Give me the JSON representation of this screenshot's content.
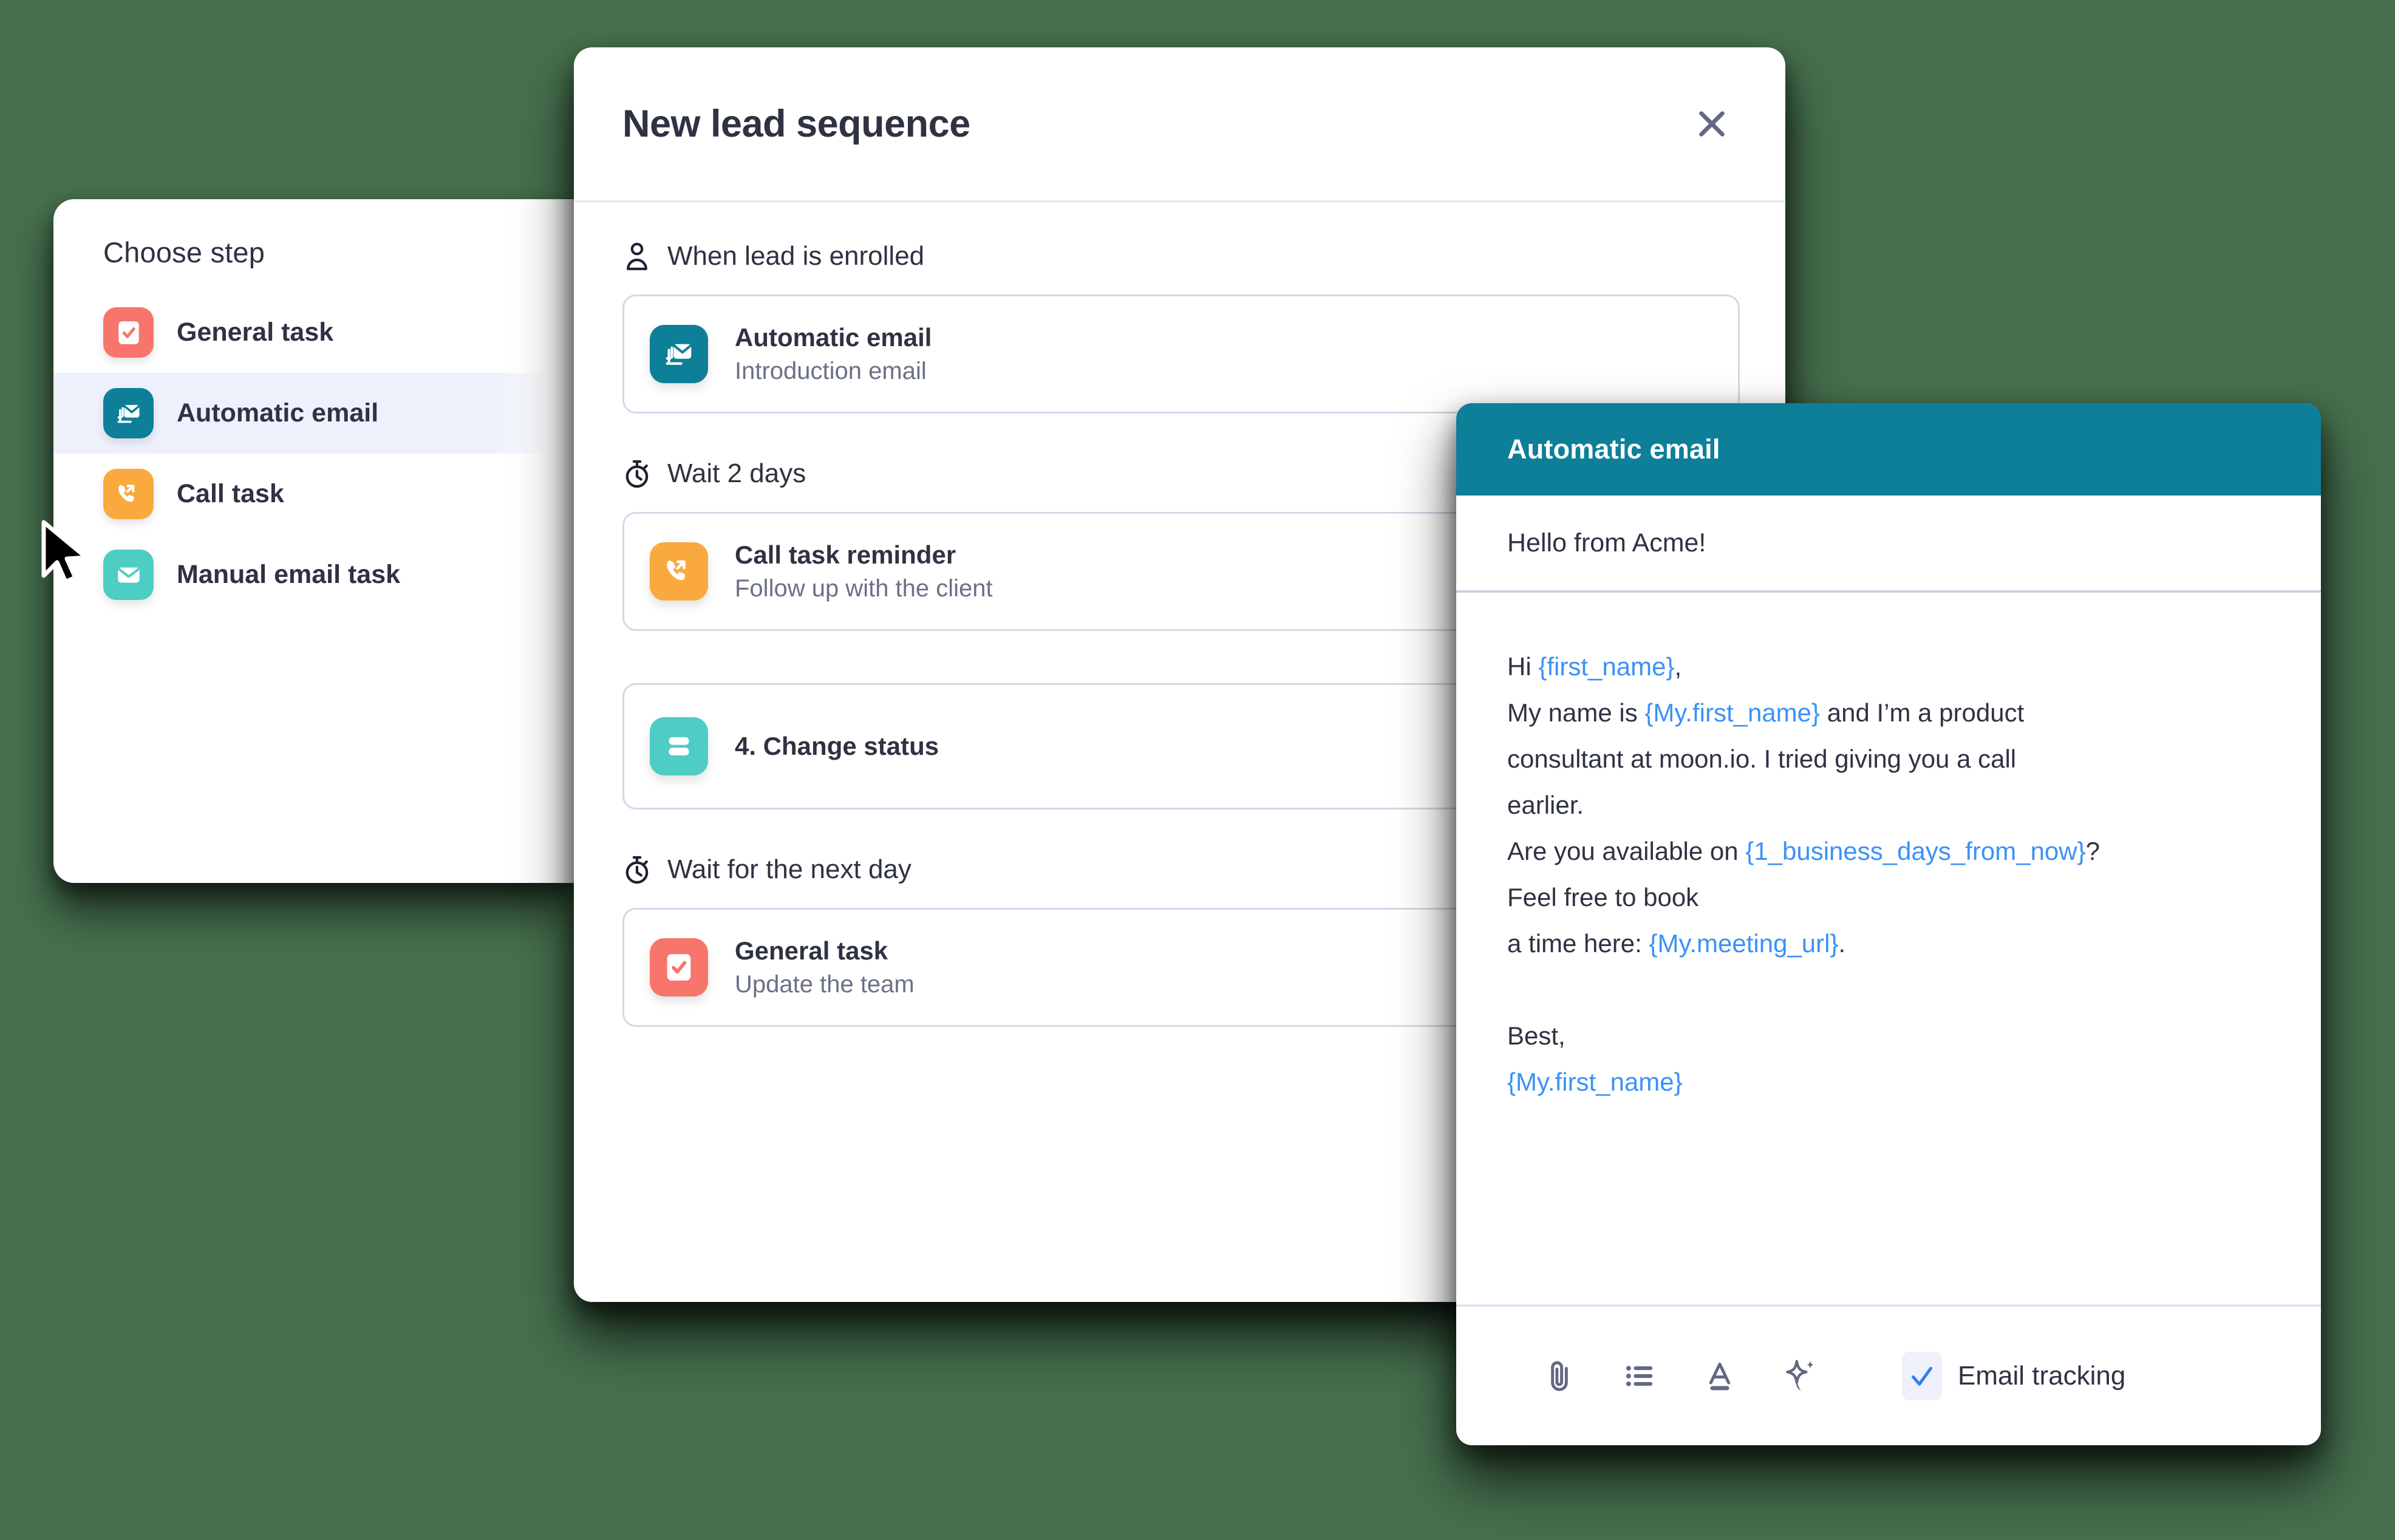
{
  "choose_step": {
    "title": "Choose step",
    "items": [
      {
        "label": "General task",
        "icon": "checkbox-task-icon",
        "color": "#f8756b",
        "selected": false
      },
      {
        "label": "Automatic email",
        "icon": "stacked-email-icon",
        "color": "#0d7f99",
        "selected": true
      },
      {
        "label": "Call task",
        "icon": "outgoing-call-icon",
        "color": "#f9a93e",
        "selected": false
      },
      {
        "label": "Manual email task",
        "icon": "envelope-icon",
        "color": "#4ecdc4",
        "selected": false
      }
    ]
  },
  "sequence_modal": {
    "title": "New lead sequence",
    "close_label": "Close",
    "sections": [
      {
        "heading": "When lead is enrolled",
        "heading_icon": "person-icon",
        "card": {
          "icon": "stacked-email-icon",
          "color": "#0d7f99",
          "title": "Automatic email",
          "subtitle": "Introduction email"
        }
      },
      {
        "heading": "Wait 2 days",
        "heading_icon": "stopwatch-icon",
        "card": {
          "icon": "outgoing-call-icon",
          "color": "#f9a93e",
          "title": "Call task reminder",
          "subtitle": "Follow up with the client"
        }
      },
      {
        "heading": "",
        "heading_icon": "",
        "card": {
          "icon": "status-rows-icon",
          "color": "#4ecdc4",
          "title": "4. Change status",
          "subtitle": ""
        }
      },
      {
        "heading": "Wait for the next day",
        "heading_icon": "stopwatch-icon",
        "card": {
          "icon": "checkbox-task-icon",
          "color": "#f8756b",
          "title": "General task",
          "subtitle": "Update the team"
        }
      }
    ]
  },
  "email_panel": {
    "header_title": "Automatic email",
    "subject": "Hello from Acme!",
    "body": {
      "line1_pre": "Hi ",
      "line1_var": "{first_name}",
      "line1_post": ",",
      "line2_pre": "My name is ",
      "line2_var": "{My.first_name}",
      "line2_post": " and I’m a product",
      "line3": "consultant at moon.io. I tried giving you a call",
      "line4": "earlier.",
      "line5_pre": "Are you available on ",
      "line5_var": "{1_business_days_from_now}",
      "line5_post": "?",
      "line6": "Feel free to book",
      "line7_pre": "a time here: ",
      "line7_var": "{My.meeting_url}",
      "line7_post": ".",
      "line8": "Best,",
      "line9_var": "{My.first_name}"
    },
    "toolbar": {
      "attach_label": "Attach file",
      "list_label": "Bulleted list",
      "format_label": "Text formatting",
      "ai_label": "AI assist",
      "tracking_label": "Email tracking",
      "tracking_checked": true
    }
  },
  "colors": {
    "background": "#46704e",
    "accent_teal": "#0d7f99",
    "accent_red": "#f8756b",
    "accent_orange": "#f9a93e",
    "accent_mint": "#4ecdc4",
    "selected_row": "#eef1fc",
    "variable_blue": "#3b91f7",
    "text_primary": "#2f3242",
    "text_secondary": "#6b7087"
  }
}
